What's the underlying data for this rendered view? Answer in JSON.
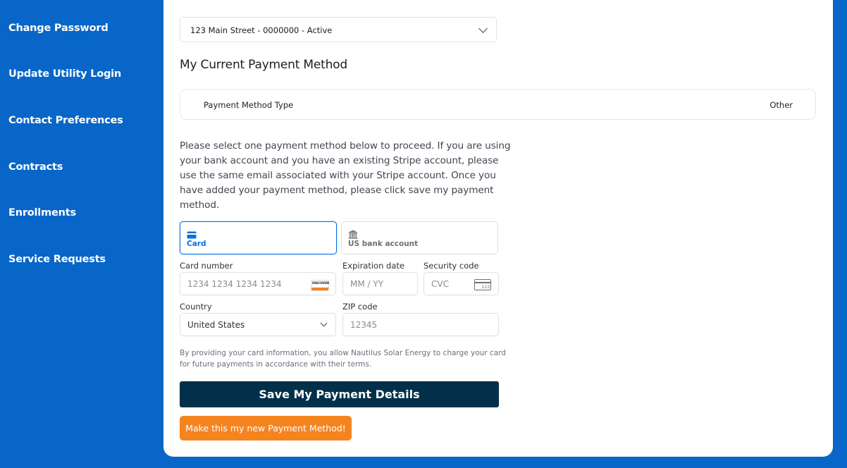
{
  "sidebar": {
    "items": [
      {
        "label": "Change Password"
      },
      {
        "label": "Update Utility Login"
      },
      {
        "label": "Contact Preferences"
      },
      {
        "label": "Contracts"
      },
      {
        "label": "Enrollments"
      },
      {
        "label": "Service Requests"
      }
    ]
  },
  "account_select": {
    "value": "123 Main Street - 0000000 - Active"
  },
  "current_method": {
    "title": "My Current Payment Method",
    "type_label": "Payment Method Type",
    "type_value": "Other"
  },
  "instructions": "Please select one payment method below to proceed. If you are using your bank account and you have an existing Stripe account, please use the same email associated with your Stripe account. Once you have added your payment method, please click save my payment method.",
  "payment_tabs": [
    {
      "label": "Card",
      "icon": "card-icon",
      "selected": true
    },
    {
      "label": "US bank account",
      "icon": "bank-icon",
      "selected": false
    }
  ],
  "form": {
    "card_number": {
      "label": "Card number",
      "placeholder": "1234 1234 1234 1234",
      "brand": "DISCOVER"
    },
    "expiration": {
      "label": "Expiration date",
      "placeholder": "MM / YY"
    },
    "security": {
      "label": "Security code",
      "placeholder": "CVC",
      "icon_text": "123"
    },
    "country": {
      "label": "Country",
      "value": "United States"
    },
    "zip": {
      "label": "ZIP code",
      "placeholder": "12345"
    }
  },
  "terms": "By providing your card information, you allow Nautilus Solar Energy to charge your card for future payments in accordance with their terms.",
  "buttons": {
    "save": "Save My Payment Details",
    "make_default": "Make this my new Payment Method!"
  },
  "colors": {
    "sidebar_bg": "#0866c8",
    "accent": "#0570de",
    "save_button": "#02304a",
    "default_button": "#f5841f"
  }
}
